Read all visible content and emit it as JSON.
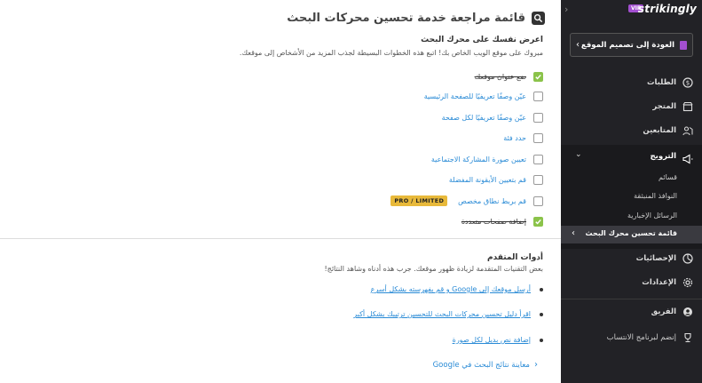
{
  "main": {
    "title": "قائمة مراجعة خدمة تحسين محركات البحث",
    "section1": {
      "title": "اعرض نفسك على محرك البحث",
      "desc": "مبروك على موقع الويب الخاص بك! اتبع هذه الخطوات البسيطة لجذب المزيد من الأشخاص إلى موقعك."
    },
    "tasks": [
      {
        "label": "ضع عنوان موقعك",
        "done": true
      },
      {
        "label": "عيّن وصفًا تعريفيًا للصفحة الرئيسية",
        "done": false
      },
      {
        "label": "عيّن وصفًا تعريفيًا لكل صفحة",
        "done": false
      },
      {
        "label": "حدد فئة",
        "done": false
      },
      {
        "label": "تعيين صورة المشاركة الاجتماعية",
        "done": false
      },
      {
        "label": "قم بتعيين الأيقونة المفضلة",
        "done": false
      },
      {
        "label": "قم بربط نطاق مخصص",
        "done": false,
        "badge": "PRO / LIMITED"
      },
      {
        "label": "إضافة صفحات متعددة",
        "done": true
      }
    ],
    "section2": {
      "title": "أدوات المتقدم",
      "desc": "بعض التقنيات المتقدمة لزيادة ظهور موقعك. جرب هذه أدناه وشاهد النتائج!"
    },
    "advanced": [
      "أرسل موقعك إلى Google و قم بفهرسته بشكل أسرع",
      "اقرأ دليل تحسين محركات البحث للتحسين ترتيبك بشكل أكبر",
      "إضافة نص بديل لكل صورة"
    ],
    "preview": "معاينة نتائج البحث في Google"
  },
  "sidebar": {
    "logo": "strikingly",
    "vip": "VIP",
    "back": "العودة إلى تصميم الموقع",
    "nav_top": [
      {
        "label": "الطلبات",
        "icon": "orders-icon"
      },
      {
        "label": "المتجر",
        "icon": "store-icon"
      },
      {
        "label": "المتابعين",
        "icon": "followers-icon"
      }
    ],
    "promotion": {
      "label": "الترويج",
      "icon": "megaphone-icon",
      "subs": [
        "قسائم",
        "النوافذ المنبثقة",
        "الرسائل الإخبارية"
      ],
      "active": "قائمة تحسين محرك البحث"
    },
    "nav_bottom": [
      {
        "label": "الإحصائيات",
        "icon": "stats-icon"
      },
      {
        "label": "الإعدادات",
        "icon": "settings-icon"
      }
    ],
    "nav_extra": [
      {
        "label": "الفريق",
        "icon": "team-icon"
      },
      {
        "label": "إنضم لبرنامج الانتساب",
        "icon": "trophy-icon"
      }
    ]
  },
  "colors": {
    "sidebar_bg": "#222226",
    "accent_link": "#2a8bd6",
    "check_green": "#8bc34a",
    "vip_purple": "#a34fd0",
    "pro_badge": "#e8b93a"
  }
}
